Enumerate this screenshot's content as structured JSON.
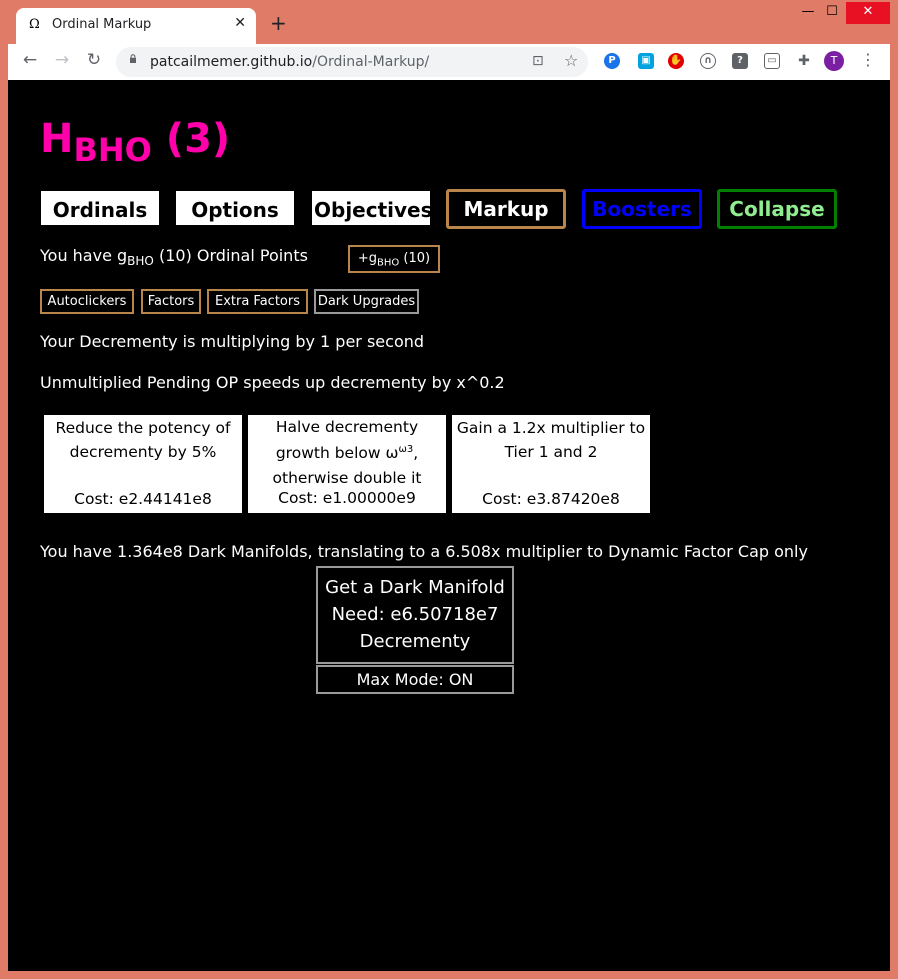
{
  "browser": {
    "tab_title": "Ordinal Markup",
    "tab_favicon": "Ω",
    "url_domain": "patcailmemer.github.io",
    "url_path": "/Ordinal-Markup/",
    "avatar_letter": "T"
  },
  "game": {
    "title_main": "H",
    "title_sub": "BHO",
    "title_arg": " (3)",
    "tabs": [
      "Ordinals",
      "Options",
      "Objectives",
      "Markup",
      "Boosters",
      "Collapse"
    ],
    "op_prefix": "You have g",
    "op_sub": "BHO",
    "op_suffix": " (10) Ordinal Points",
    "plus_prefix": "+g",
    "plus_sub": "BHO",
    "plus_suffix": " (10)",
    "subtabs": [
      "Autoclickers",
      "Factors",
      "Extra Factors",
      "Dark Upgrades"
    ],
    "decrementy_rate": "Your Decrementy is multiplying by 1 per second",
    "pending_op_text": "Unmultiplied Pending OP speeds up decrementy by x^0.2",
    "upgrades": [
      {
        "desc": "Reduce the potency of decrementy by 5%",
        "cost": "Cost: e2.44141e8"
      },
      {
        "desc_a": "Halve decrementy growth below ω",
        "desc_sup": "ω3",
        "desc_b": ", otherwise double it",
        "cost": "Cost: e1.00000e9"
      },
      {
        "desc": "Gain a 1.2x multiplier to Tier 1 and 2",
        "cost": "Cost: e3.87420e8"
      }
    ],
    "manifold_text": "You have 1.364e8 Dark Manifolds, translating to a 6.508x multiplier to Dynamic Factor Cap only",
    "manifold_button": [
      "Get a Dark Manifold",
      "Need: e6.50718e7",
      "Decrementy"
    ],
    "max_mode": "Max Mode: ON"
  },
  "colors": {
    "title": "#ff00aa",
    "markup_border": "#b8864b",
    "boosters": "#0000ff",
    "collapse_text": "#90ee90",
    "collapse_border": "#008000"
  }
}
